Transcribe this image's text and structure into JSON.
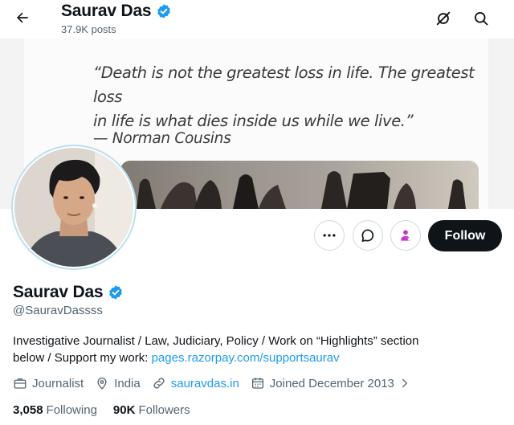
{
  "header": {
    "name": "Saurav Das",
    "posts_count": "37.9K posts",
    "icons": [
      "back-arrow-icon",
      "grok-icon",
      "search-icon"
    ]
  },
  "banner": {
    "quote_line1": "“Death is not the greatest loss in life. The greatest loss",
    "quote_line2": "in life is what dies inside us while we live.”",
    "author": "— Norman Cousins"
  },
  "actions": {
    "more_icon": "more-icon",
    "message_icon": "message-icon",
    "subscribe_icon": "subscribe-icon",
    "follow_label": "Follow"
  },
  "profile": {
    "name": "Saurav Das",
    "handle": "@SauravDassss",
    "bio_text_1": "Investigative Journalist / Law, Judiciary, Policy / Work on “Highlights” section",
    "bio_text_2": "below / Support my work: ",
    "bio_link": "pages.razorpay.com/supportsaurav",
    "profession": "Journalist",
    "location": "India",
    "website": "sauravdas.in",
    "joined": "Joined December 2013",
    "following_count": "3,058",
    "following_label": "Following",
    "followers_count": "90K",
    "followers_label": "Followers"
  },
  "colors": {
    "accent": "#1d9bf0",
    "text": "#0f1419",
    "secondary": "#536471",
    "follow_button": "#0f1419",
    "subscribe_icon": "#c936cc"
  }
}
